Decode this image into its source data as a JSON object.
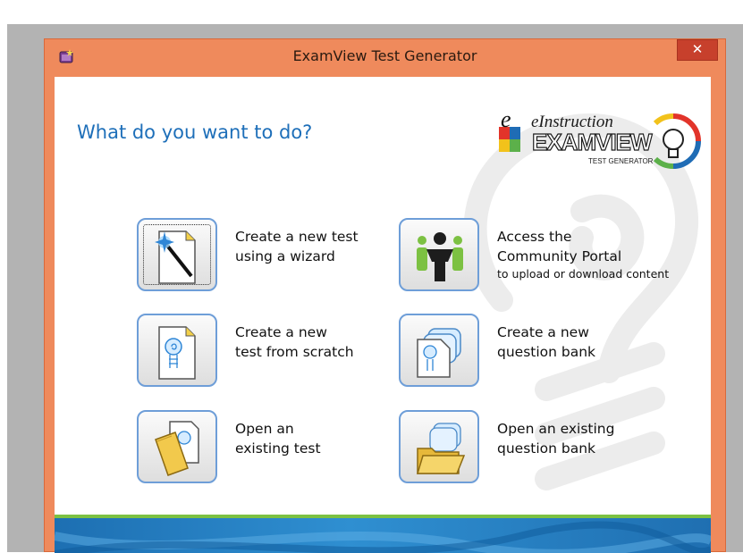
{
  "window": {
    "title": "ExamView Test Generator",
    "close_label": "✕"
  },
  "header": {
    "heading": "What do you want to do?"
  },
  "logo": {
    "small": "eInstruction",
    "big": "EXAMVIEW",
    "sub": "TEST GENERATOR"
  },
  "actions": [
    {
      "line1": "Create a new test",
      "line2": "using a wizard",
      "icon": "wizard-wand-icon"
    },
    {
      "line1": "Access the",
      "line2": "Community Portal",
      "line3": "to upload or download content",
      "icon": "community-people-icon"
    },
    {
      "line1": "Create a new",
      "line2": "test from scratch",
      "icon": "new-test-document-icon"
    },
    {
      "line1": "Create a new",
      "line2": "question bank",
      "icon": "new-question-bank-icon"
    },
    {
      "line1": "Open an",
      "line2": "existing test",
      "icon": "open-test-folder-icon"
    },
    {
      "line1": "Open an existing",
      "line2": "question bank",
      "icon": "open-question-bank-folder-icon"
    }
  ],
  "colors": {
    "titlebar": "#ef8a5c",
    "close": "#c7402c",
    "heading": "#1e6fb9",
    "button_border": "#6e9ed8",
    "footer_blue": "#2f8fd1",
    "footer_green": "#7cc142"
  }
}
